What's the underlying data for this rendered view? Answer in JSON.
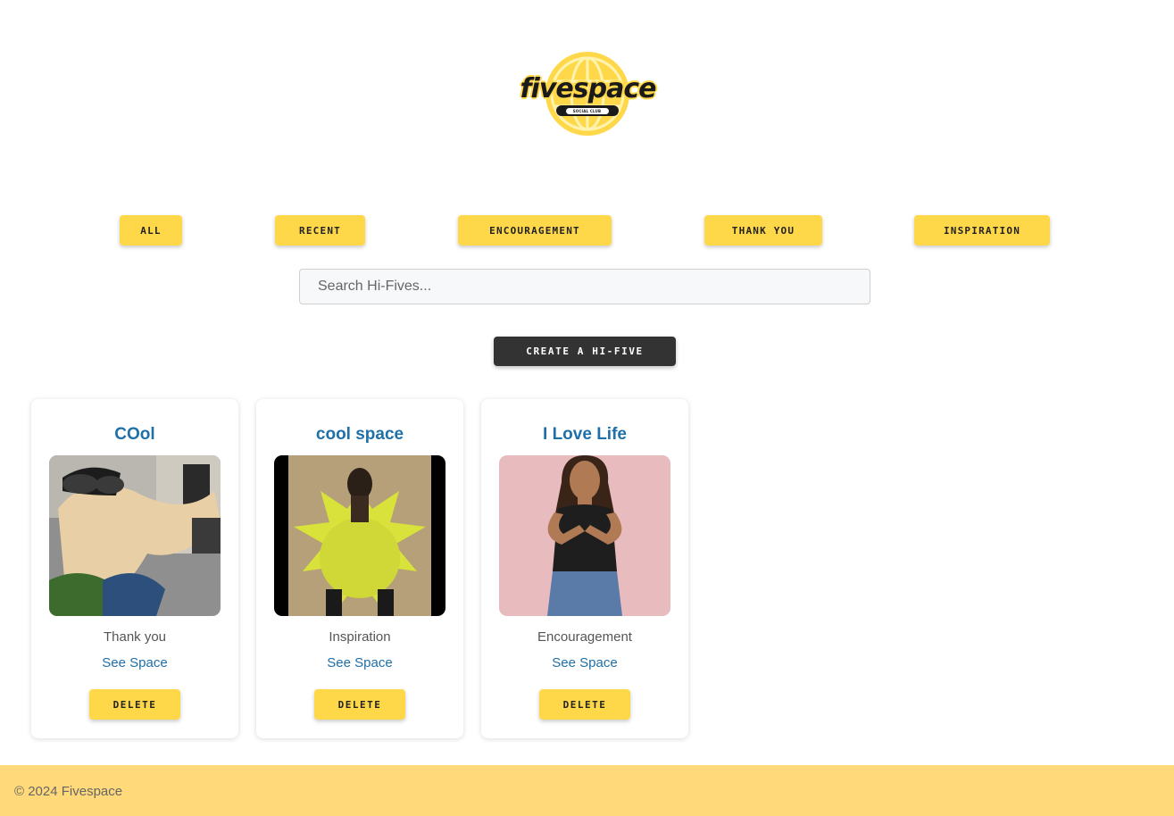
{
  "brand": {
    "name": "fivespace",
    "tagline": "SOCIAL CLUB",
    "accent": "#ffd84a"
  },
  "filters": [
    {
      "label": "ALL"
    },
    {
      "label": "RECENT"
    },
    {
      "label": "ENCOURAGEMENT"
    },
    {
      "label": "THANK YOU"
    },
    {
      "label": "INSPIRATION"
    }
  ],
  "search": {
    "placeholder": "Search Hi-Fives...",
    "value": ""
  },
  "create_button": {
    "label": "CREATE A HI-FIVE"
  },
  "cards": [
    {
      "title": "COol",
      "category": "Thank you",
      "link": "See Space",
      "delete_label": "DELETE",
      "image": "dog-driving-gif"
    },
    {
      "title": "cool space",
      "category": "Inspiration",
      "link": "See Space",
      "delete_label": "DELETE",
      "image": "inflatable-costume-gif"
    },
    {
      "title": "I Love Life",
      "category": "Encouragement",
      "link": "See Space",
      "delete_label": "DELETE",
      "image": "woman-clapping-gif"
    }
  ],
  "footer": {
    "copyright": "© 2024 Fivespace"
  }
}
